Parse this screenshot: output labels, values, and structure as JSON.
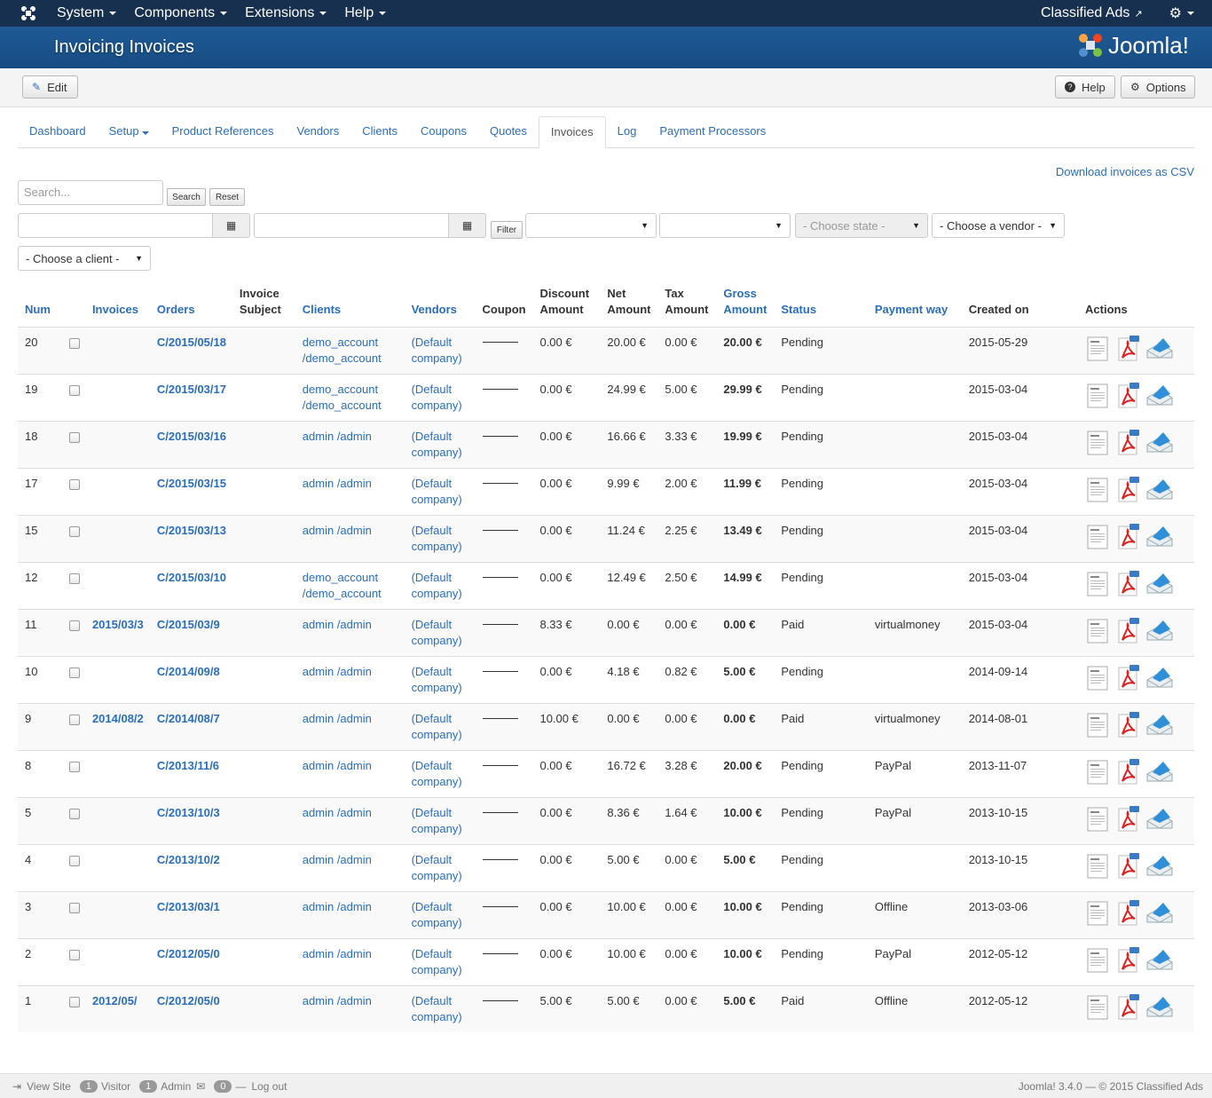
{
  "navbar": {
    "menu": [
      "System",
      "Components",
      "Extensions",
      "Help"
    ],
    "site_name": "Classified Ads"
  },
  "header": {
    "title": "Invoicing Invoices",
    "brand": "Joomla!"
  },
  "toolbar": {
    "edit": "Edit",
    "help": "Help",
    "options": "Options"
  },
  "tabs": [
    "Dashboard",
    "Setup",
    "Product References",
    "Vendors",
    "Clients",
    "Coupons",
    "Quotes",
    "Invoices",
    "Log",
    "Payment Processors"
  ],
  "active_tab": "Invoices",
  "download_csv": "Download invoices as CSV",
  "filters": {
    "search_placeholder": "Search...",
    "search_button": "Search",
    "reset_button": "Reset",
    "filter_button": "Filter",
    "state_select": "- Choose state -",
    "vendor_select": "- Choose a vendor -",
    "client_select": "- Choose a client -"
  },
  "columns": {
    "num": "Num",
    "invoices": "Invoices",
    "orders": "Orders",
    "invoice_subject": "Invoice Subject",
    "clients": "Clients",
    "vendors": "Vendors",
    "coupon": "Coupon",
    "discount_amount": "Discount Amount",
    "net_amount": "Net Amount",
    "tax_amount": "Tax Amount",
    "gross_amount": "Gross Amount",
    "status": "Status",
    "payment_way": "Payment way",
    "created_on": "Created on",
    "actions": "Actions"
  },
  "rows": [
    {
      "num": "20",
      "invoice": "",
      "order": "C/2015/05/18",
      "client": "demo_account /demo_account",
      "vendor": "(Default company)",
      "discount": "0.00 €",
      "net": "20.00 €",
      "tax": "0.00 €",
      "gross": "20.00 €",
      "status": "Pending",
      "payment": "",
      "created": "2015-05-29"
    },
    {
      "num": "19",
      "invoice": "",
      "order": "C/2015/03/17",
      "client": "demo_account /demo_account",
      "vendor": "(Default company)",
      "discount": "0.00 €",
      "net": "24.99 €",
      "tax": "5.00 €",
      "gross": "29.99 €",
      "status": "Pending",
      "payment": "",
      "created": "2015-03-04"
    },
    {
      "num": "18",
      "invoice": "",
      "order": "C/2015/03/16",
      "client": "admin /admin",
      "vendor": "(Default company)",
      "discount": "0.00 €",
      "net": "16.66 €",
      "tax": "3.33 €",
      "gross": "19.99 €",
      "status": "Pending",
      "payment": "",
      "created": "2015-03-04"
    },
    {
      "num": "17",
      "invoice": "",
      "order": "C/2015/03/15",
      "client": "admin /admin",
      "vendor": "(Default company)",
      "discount": "0.00 €",
      "net": "9.99 €",
      "tax": "2.00 €",
      "gross": "11.99 €",
      "status": "Pending",
      "payment": "",
      "created": "2015-03-04"
    },
    {
      "num": "15",
      "invoice": "",
      "order": "C/2015/03/13",
      "client": "admin /admin",
      "vendor": "(Default company)",
      "discount": "0.00 €",
      "net": "11.24 €",
      "tax": "2.25 €",
      "gross": "13.49 €",
      "status": "Pending",
      "payment": "",
      "created": "2015-03-04"
    },
    {
      "num": "12",
      "invoice": "",
      "order": "C/2015/03/10",
      "client": "demo_account /demo_account",
      "vendor": "(Default company)",
      "discount": "0.00 €",
      "net": "12.49 €",
      "tax": "2.50 €",
      "gross": "14.99 €",
      "status": "Pending",
      "payment": "",
      "created": "2015-03-04"
    },
    {
      "num": "11",
      "invoice": "2015/03/3",
      "order": "C/2015/03/9",
      "client": "admin /admin",
      "vendor": "(Default company)",
      "discount": "8.33 €",
      "net": "0.00 €",
      "tax": "0.00 €",
      "gross": "0.00 €",
      "status": "Paid",
      "payment": "virtualmoney",
      "created": "2015-03-04"
    },
    {
      "num": "10",
      "invoice": "",
      "order": "C/2014/09/8",
      "client": "admin /admin",
      "vendor": "(Default company)",
      "discount": "0.00 €",
      "net": "4.18 €",
      "tax": "0.82 €",
      "gross": "5.00 €",
      "status": "Pending",
      "payment": "",
      "created": "2014-09-14"
    },
    {
      "num": "9",
      "invoice": "2014/08/2",
      "order": "C/2014/08/7",
      "client": "admin /admin",
      "vendor": "(Default company)",
      "discount": "10.00 €",
      "net": "0.00 €",
      "tax": "0.00 €",
      "gross": "0.00 €",
      "status": "Paid",
      "payment": "virtualmoney",
      "created": "2014-08-01"
    },
    {
      "num": "8",
      "invoice": "",
      "order": "C/2013/11/6",
      "client": "admin /admin",
      "vendor": "(Default company)",
      "discount": "0.00 €",
      "net": "16.72 €",
      "tax": "3.28 €",
      "gross": "20.00 €",
      "status": "Pending",
      "payment": "PayPal",
      "created": "2013-11-07"
    },
    {
      "num": "5",
      "invoice": "",
      "order": "C/2013/10/3",
      "client": "admin /admin",
      "vendor": "(Default company)",
      "discount": "0.00 €",
      "net": "8.36 €",
      "tax": "1.64 €",
      "gross": "10.00 €",
      "status": "Pending",
      "payment": "PayPal",
      "created": "2013-10-15"
    },
    {
      "num": "4",
      "invoice": "",
      "order": "C/2013/10/2",
      "client": "admin /admin",
      "vendor": "(Default company)",
      "discount": "0.00 €",
      "net": "5.00 €",
      "tax": "0.00 €",
      "gross": "5.00 €",
      "status": "Pending",
      "payment": "",
      "created": "2013-10-15"
    },
    {
      "num": "3",
      "invoice": "",
      "order": "C/2013/03/1",
      "client": "admin /admin",
      "vendor": "(Default company)",
      "discount": "0.00 €",
      "net": "10.00 €",
      "tax": "0.00 €",
      "gross": "10.00 €",
      "status": "Pending",
      "payment": "Offline",
      "created": "2013-03-06"
    },
    {
      "num": "2",
      "invoice": "",
      "order": "C/2012/05/0",
      "client": "admin /admin",
      "vendor": "(Default company)",
      "discount": "0.00 €",
      "net": "10.00 €",
      "tax": "0.00 €",
      "gross": "10.00 €",
      "status": "Pending",
      "payment": "PayPal",
      "created": "2012-05-12"
    },
    {
      "num": "1",
      "invoice": "2012/05/",
      "order": "C/2012/05/0",
      "client": "admin /admin",
      "vendor": "(Default company)",
      "discount": "5.00 €",
      "net": "5.00 €",
      "tax": "0.00 €",
      "gross": "5.00 €",
      "status": "Paid",
      "payment": "Offline",
      "created": "2012-05-12"
    }
  ],
  "footer": {
    "view_site": "View Site",
    "visitors_count": "1",
    "visitor": "Visitor",
    "admins_count": "1",
    "admin": "Admin",
    "messages_count": "0",
    "logout": "Log out",
    "copyright": "Joomla! 3.4.0 — © 2015 Classified Ads"
  },
  "colors": {
    "navbar": "#17304f",
    "header": "#1f5a96",
    "link": "#2a6ebb"
  },
  "icons": [
    "joomla-icon",
    "external-link-icon",
    "gear-icon",
    "edit-icon",
    "help-icon",
    "calendar-icon",
    "view-invoice-icon",
    "pdf-icon",
    "email-icon"
  ]
}
